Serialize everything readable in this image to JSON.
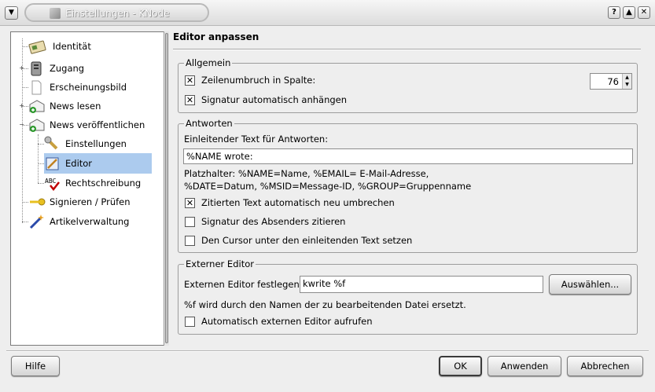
{
  "window": {
    "title": "Einstellungen - KNode"
  },
  "tree": {
    "items": [
      {
        "label": "Identität",
        "icon": "identity-card-icon"
      },
      {
        "label": "Zugang",
        "icon": "server-icon"
      },
      {
        "label": "Erscheinungsbild",
        "icon": "document-icon"
      },
      {
        "label": "News lesen",
        "icon": "news-read-icon"
      },
      {
        "label": "News veröffentlichen",
        "icon": "news-post-icon"
      },
      {
        "label": "Einstellungen",
        "icon": "settings-tools-icon"
      },
      {
        "label": "Editor",
        "icon": "editor-icon"
      },
      {
        "label": "Rechtschreibung",
        "icon": "spellcheck-icon"
      },
      {
        "label": "Signieren / Prüfen",
        "icon": "key-icon"
      },
      {
        "label": "Artikelverwaltung",
        "icon": "wand-icon"
      }
    ]
  },
  "page": {
    "title": "Editor anpassen"
  },
  "general": {
    "legend": "Allgemein",
    "wrap_label": "Zeilenumbruch in Spalte:",
    "wrap_checked": true,
    "wrap_column": "76",
    "append_sig_label": "Signatur automatisch anhängen",
    "append_sig_checked": true
  },
  "reply": {
    "legend": "Antworten",
    "intro_label": "Einleitender Text für Antworten:",
    "intro_value": "%NAME wrote:",
    "placeholder_line1": "Platzhalter: %NAME=Name, %EMAIL= E-Mail-Adresse,",
    "placeholder_line2": "%DATE=Datum, %MSID=Message-ID, %GROUP=Gruppenname",
    "rewrap_label": "Zitierten Text automatisch neu umbrechen",
    "rewrap_checked": true,
    "quote_sig_label": "Signatur des Absenders zitieren",
    "quote_sig_checked": false,
    "cursor_label": "Den Cursor unter den einleitenden Text setzen",
    "cursor_checked": false
  },
  "external": {
    "legend": "Externer Editor",
    "editor_label": "Externen Editor festlegen:",
    "editor_value": "kwrite %f",
    "choose_button": "Auswählen...",
    "hint": "%f wird durch den Namen der zu bearbeitenden Datei ersetzt.",
    "auto_start_label": "Automatisch externen Editor aufrufen",
    "auto_start_checked": false
  },
  "footer": {
    "help": "Hilfe",
    "ok": "OK",
    "apply": "Anwenden",
    "cancel": "Abbrechen"
  },
  "title_buttons": {
    "help": "?",
    "shade": "▲",
    "close": "✕"
  }
}
